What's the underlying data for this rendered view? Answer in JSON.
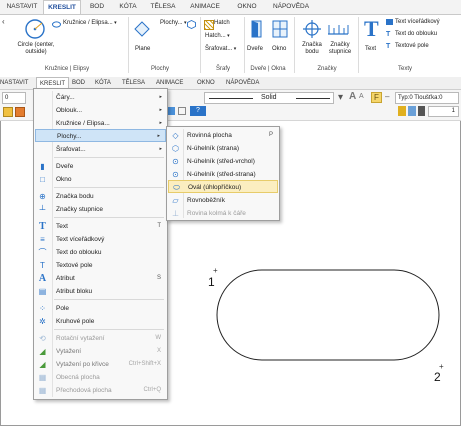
{
  "ribbon_tabs": [
    "NASTAVIT",
    "KRESLIT",
    "BOD",
    "KÓTA",
    "TĚLESA",
    "ANIMACE",
    "OKNO",
    "NÁPOVĚDA"
  ],
  "ribbon": {
    "circle_label": "Circle (center, outside)",
    "kruznice_dd": "Kružnice / Elipsa...",
    "group_kruznice": "Kružnice | Elipsy",
    "plochy_dd": "Plochy...",
    "plane": "Plane",
    "group_plochy": "Plochy",
    "hatch": "Hatch",
    "hatch_dd": "Hatch...",
    "srafovat_dd": "Šrafovat...",
    "group_srafy": "Šrafy",
    "dvere": "Dveře",
    "okno": "Okno",
    "group_dvere": "Dveře | Okna",
    "znacka_bodu": "Značka bodu",
    "znacky_stupnice": "Značky stupnice",
    "group_znacky": "Značky",
    "text": "Text",
    "text_viceradkovy": "Text víceřádkový",
    "text_do_oblouku": "Text do oblouku",
    "textove_pole": "Textové pole",
    "group_texty": "Texty"
  },
  "tabs2": [
    "NASTAVIT",
    "KRESLIT",
    "BOD",
    "KÓTA",
    "TĚLESA",
    "ANIMACE",
    "OKNO",
    "NÁPOVĚDA"
  ],
  "toolbar": {
    "field_left": "0",
    "linestyle": "Solid",
    "typ": "Typ:0",
    "tloustka": "Tloušťka:0",
    "f_button": "F",
    "font_a_big": "A",
    "font_a_small": "A",
    "help": "?",
    "num": "1"
  },
  "menu": {
    "items": [
      {
        "label": "Čáry...",
        "arrow": "▸"
      },
      {
        "label": "Oblouk...",
        "arrow": "▸"
      },
      {
        "label": "Kružnice / Elipsa...",
        "arrow": "▸"
      },
      {
        "label": "Plochy...",
        "arrow": "▸"
      },
      {
        "label": "Šrafovat...",
        "arrow": "▸"
      },
      {
        "label": "Dveře",
        "icon": "door"
      },
      {
        "label": "Okno",
        "icon": "window"
      },
      {
        "label": "Značka bodu",
        "icon": "point"
      },
      {
        "label": "Značky stupnice",
        "icon": "scale"
      },
      {
        "label": "Text",
        "shortcut": "T",
        "icon": "text"
      },
      {
        "label": "Text víceřádkový",
        "icon": "multi"
      },
      {
        "label": "Text do oblouku",
        "icon": "arc"
      },
      {
        "label": "Textové pole",
        "icon": "textbox"
      },
      {
        "label": "Atribut",
        "shortcut": "S",
        "icon": "attr"
      },
      {
        "label": "Atribut bloku",
        "icon": "attrblock"
      },
      {
        "label": "Pole",
        "icon": "field"
      },
      {
        "label": "Kruhové pole",
        "icon": "circfield"
      },
      {
        "label": "Rotační vytažení",
        "shortcut": "W",
        "disabled": true
      },
      {
        "label": "Vytažení",
        "shortcut": "X"
      },
      {
        "label": "Vytažení po křivce",
        "shortcut": "Ctrl+Shift+X"
      },
      {
        "label": "Obecná plocha",
        "disabled": true
      },
      {
        "label": "Přechodová plocha",
        "shortcut": "Ctrl+Q",
        "disabled": true
      }
    ]
  },
  "submenu": {
    "items": [
      {
        "label": "Rovinná plocha",
        "shortcut": "P"
      },
      {
        "label": "N-úhelník (strana)"
      },
      {
        "label": "N-úhelník (střed-vrchol)"
      },
      {
        "label": "N-úhelník (střed-strana)"
      },
      {
        "label": "Ovál (úhlopříčkou)"
      },
      {
        "label": "Rovnoběžník"
      },
      {
        "label": "Rovina kolmá k čáře",
        "disabled": true
      }
    ]
  },
  "canvas": {
    "point1": "1",
    "point2": "2",
    "plus": "+"
  },
  "colors": {
    "accent": "#1f4e9c",
    "menu_highlight": "#cfe4f7",
    "submenu_highlight": "#fbeec0",
    "icon_blue": "#2a73c8",
    "text_yellow": "#f5d56a"
  }
}
